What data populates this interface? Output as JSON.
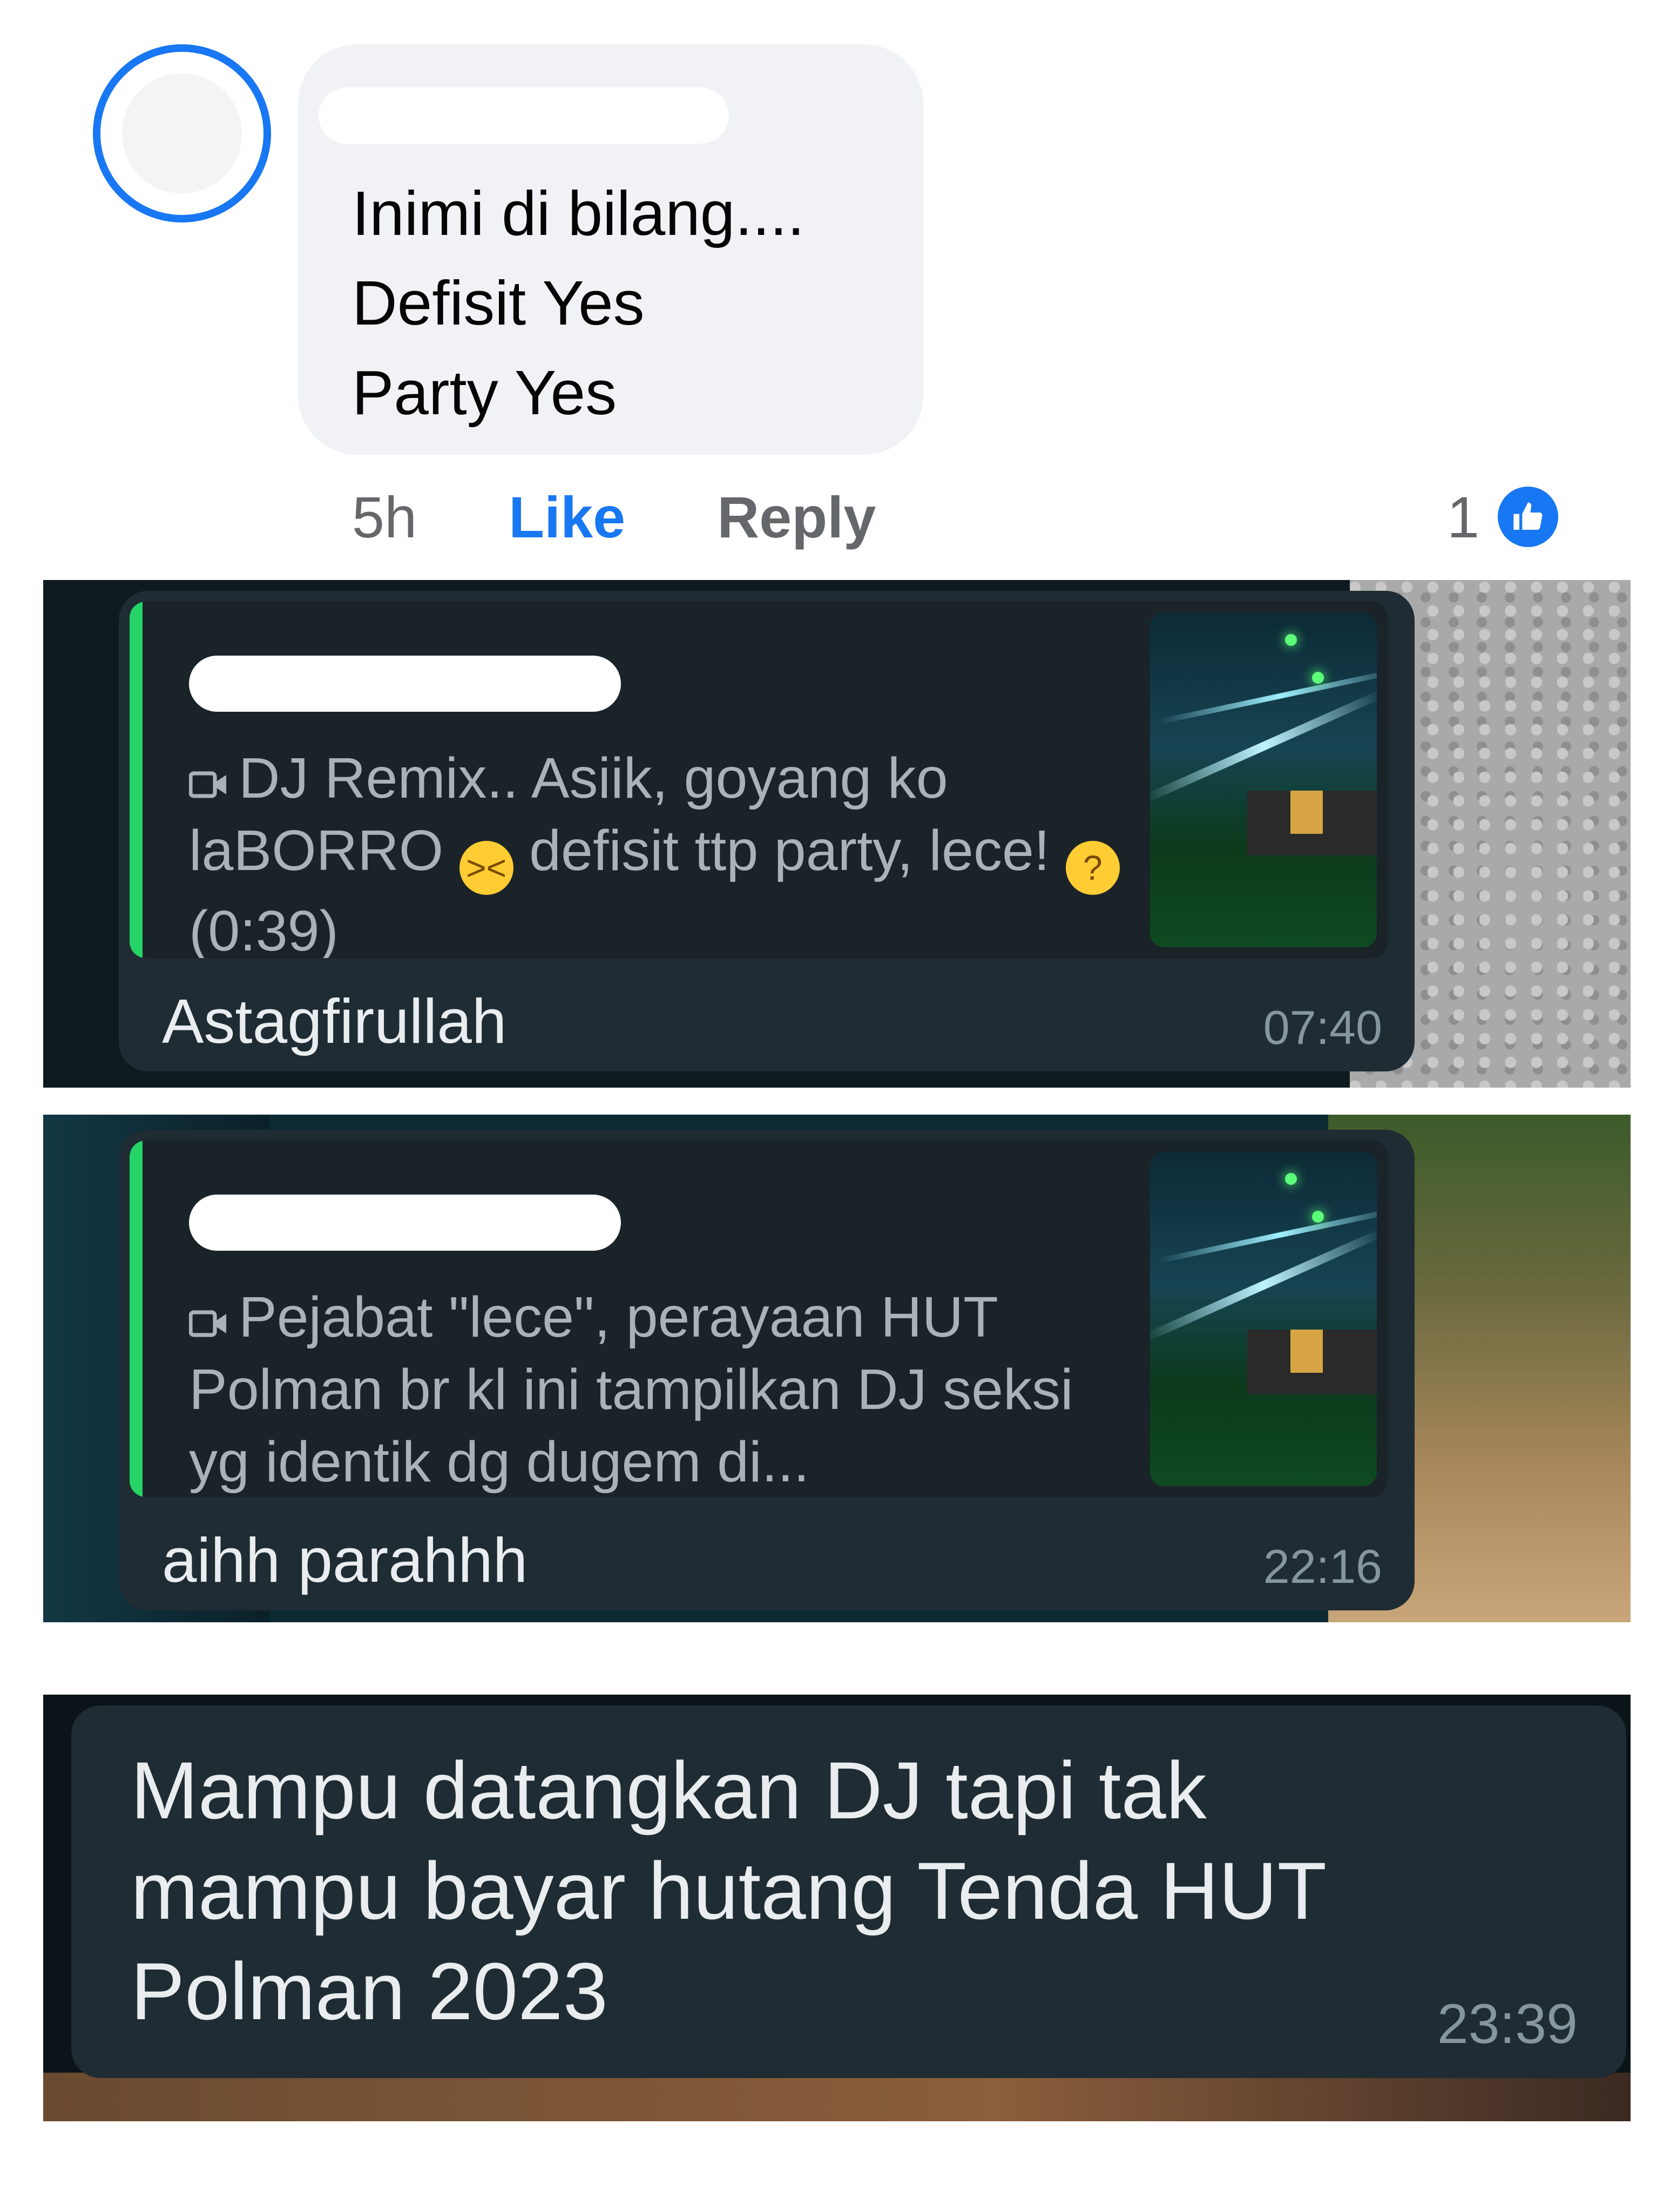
{
  "fb_comment": {
    "lines": [
      "Inimi di bilang....",
      "Defisit Yes",
      "Party Yes"
    ],
    "time": "5h",
    "like_label": "Like",
    "reply_label": "Reply",
    "reaction_count": "1",
    "reaction_icon": "thumbs-up-icon",
    "accent_color": "#1877f2"
  },
  "wa_messages": [
    {
      "quote_icon": "video-icon",
      "quote_part1": "DJ Remix.. Asiik, goyang ko laBORRO",
      "quote_emoji1": "squinting-face-with-tongue-emoji",
      "quote_part2": "defisit ttp party, lece!",
      "quote_emoji2": "thinking-face-emoji",
      "quote_part3": "(0:39)",
      "text": "Astagfirullah",
      "time": "07:40"
    },
    {
      "quote_icon": "video-icon",
      "quote_text": "Pejabat \"lece\", perayaan HUT Polman br kl ini tampilkan DJ seksi yg identik dg dugem di...",
      "text": "aihh parahhh",
      "time": "22:16"
    },
    {
      "text": "Mampu datangkan DJ tapi tak mampu bayar hutang Tenda HUT Polman 2023",
      "time": "23:39"
    }
  ],
  "colors": {
    "wa_bubble": "#1f2c33",
    "wa_quote_bar": "#25d366",
    "wa_time": "#8696a0"
  }
}
